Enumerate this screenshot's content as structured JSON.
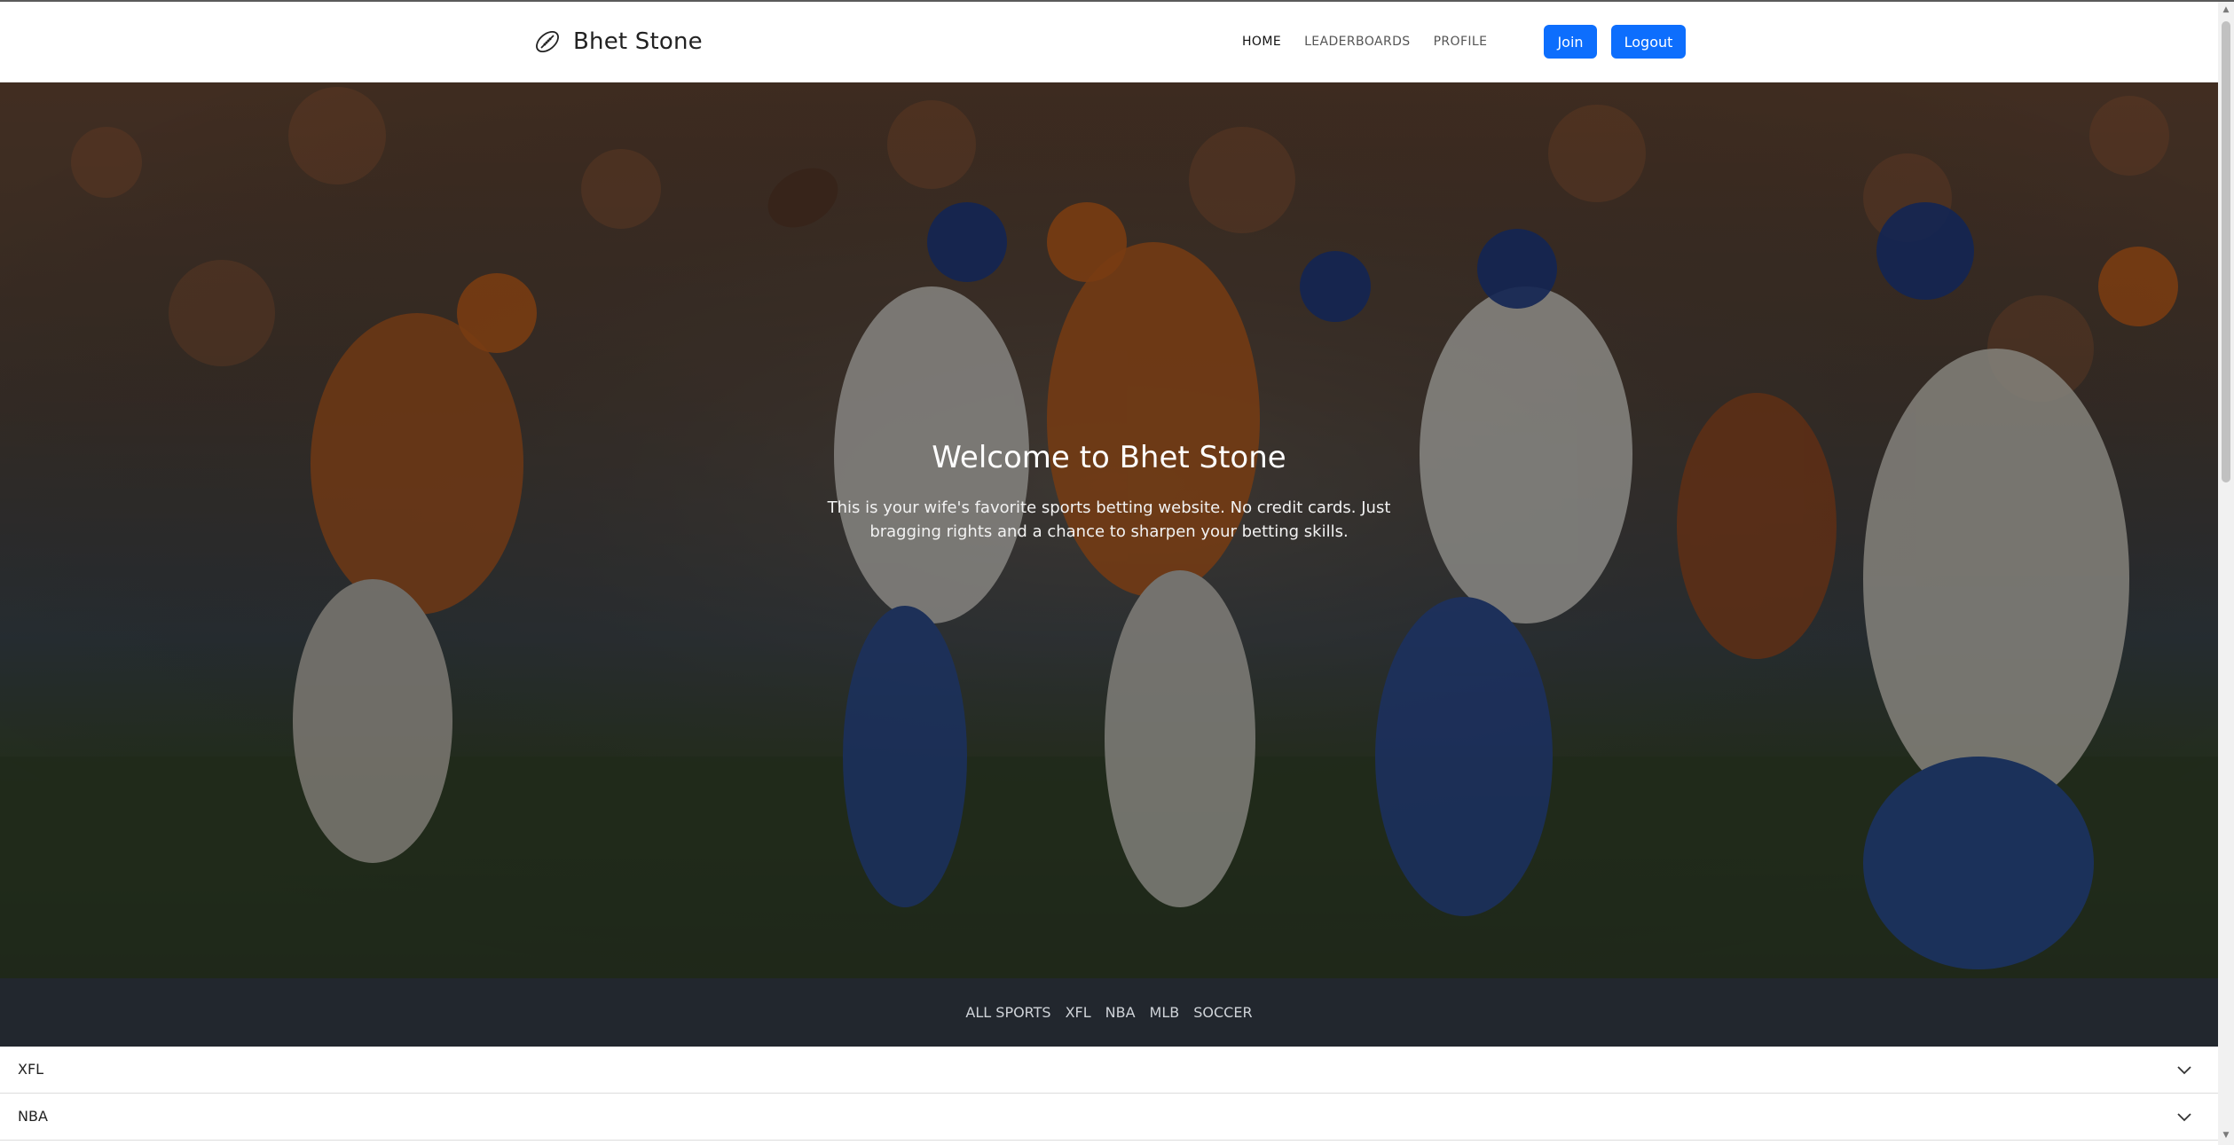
{
  "navbar": {
    "brand": "Bhet Stone",
    "brand_icon": "football-icon",
    "links": [
      {
        "label": "HOME",
        "active": true
      },
      {
        "label": "LEADERBOARDS",
        "active": false
      },
      {
        "label": "PROFILE",
        "active": false
      }
    ],
    "join_label": "Join",
    "logout_label": "Logout",
    "accent_color": "#0d6efd"
  },
  "hero": {
    "title": "Welcome to Bhet Stone",
    "subtitle": "This is your wife's favorite sports betting website. No credit cards. Just bragging rights and a chance to sharpen your betting skills.",
    "background": "football-game-photo"
  },
  "sports_nav": {
    "items": [
      "ALL SPORTS",
      "XFL",
      "NBA",
      "MLB",
      "SOCCER"
    ]
  },
  "accordion": {
    "items": [
      {
        "label": "XFL",
        "icon": "chevron-down-icon"
      },
      {
        "label": "NBA",
        "icon": "chevron-down-icon"
      }
    ]
  }
}
